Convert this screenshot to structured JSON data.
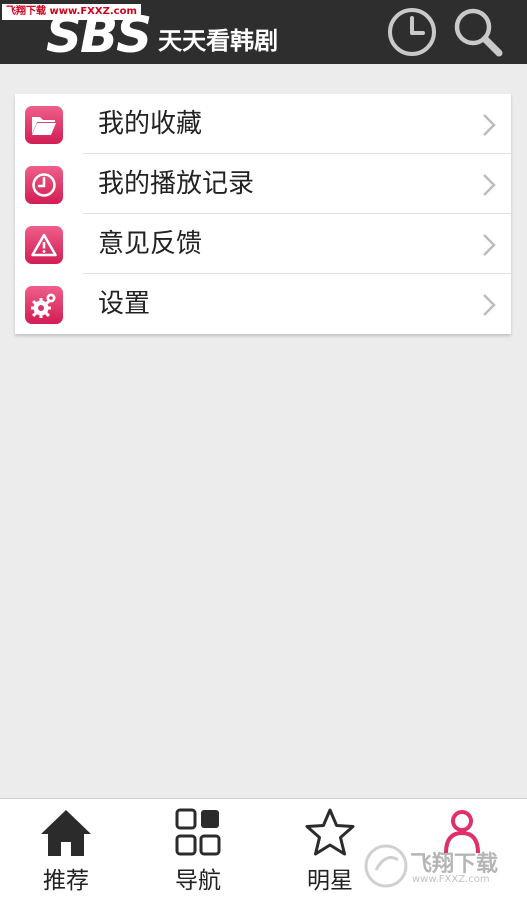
{
  "header": {
    "watermark": "飞翔下载 www.FXXZ.com",
    "logo_sbs": "SBS",
    "logo_text": "天天看韩剧",
    "history_icon": "clock-icon",
    "search_icon": "search-icon",
    "background": "#2e2e2e"
  },
  "menu": {
    "items": [
      {
        "label": "我的收藏",
        "icon": "folder-icon"
      },
      {
        "label": "我的播放记录",
        "icon": "clock-icon"
      },
      {
        "label": "意见反馈",
        "icon": "warning-icon"
      },
      {
        "label": "设置",
        "icon": "gear-icon"
      }
    ],
    "accent": "#e0306a"
  },
  "bottom_nav": {
    "items": [
      {
        "label": "推荐",
        "icon": "home-icon"
      },
      {
        "label": "导航",
        "icon": "grid-icon"
      },
      {
        "label": "明星",
        "icon": "star-icon"
      },
      {
        "label": "",
        "icon": "person-icon"
      }
    ]
  },
  "watermark_bottom": {
    "text": "飞翔下载",
    "url": "www.FXXZ.com"
  }
}
